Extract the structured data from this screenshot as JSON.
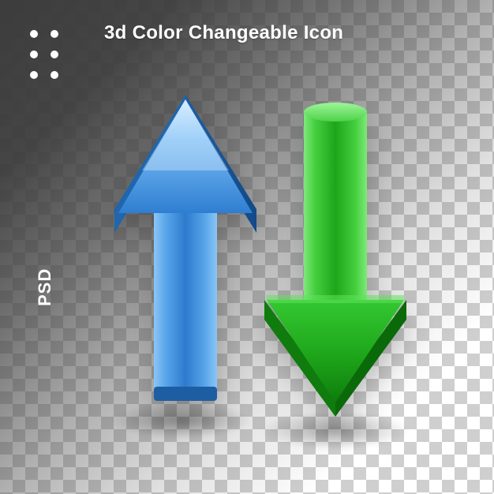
{
  "title": "3d Color Changeable Icon",
  "format_label": "PSD",
  "arrows": {
    "up": {
      "direction": "up",
      "color": "#3f96e6",
      "highlight": "#a9d7ff",
      "shadow": "#1f5aa0"
    },
    "down": {
      "direction": "down",
      "color": "#2fbf2f",
      "highlight": "#7ff07a",
      "shadow": "#178a17"
    }
  }
}
